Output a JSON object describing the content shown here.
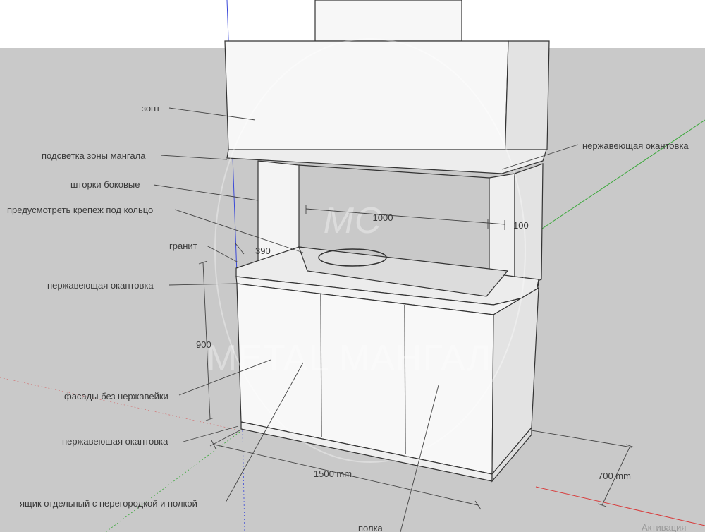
{
  "colors": {
    "sky": "#ffffff",
    "ground": "#c9c9c9",
    "panel": "#f7f7f7",
    "panel_shade": "#e3e3e3",
    "line": "#333333",
    "axis_green": "#3aa83a",
    "axis_blue": "#3a48d8",
    "axis_red": "#d83a3a"
  },
  "labels": {
    "hood": "зонт",
    "hood_light": "подсветка зоны мангала",
    "side_curtains": "шторки боковые",
    "ring_mount": "предусмотреть крепеж под кольцо",
    "granite": "гранит",
    "steel_edge_top": "нержавеющая окантовка",
    "steel_edge_mid": "нержавеющая окантовка",
    "facades": "фасады без нержавейки",
    "steel_edge_bottom": "нержавеюшая окантовка",
    "drawer": "ящик отдельный с перегородкой и полкой",
    "shelf": "полка"
  },
  "dimensions": {
    "inner_width": "1000",
    "post_width": "100",
    "counter_depth": "390",
    "height": "900",
    "width": "1500 mm",
    "depth": "700 mm"
  },
  "watermark": {
    "brand": "METAL МАНГАЛ",
    "monogram": "MC"
  },
  "os_notice": "Активация"
}
